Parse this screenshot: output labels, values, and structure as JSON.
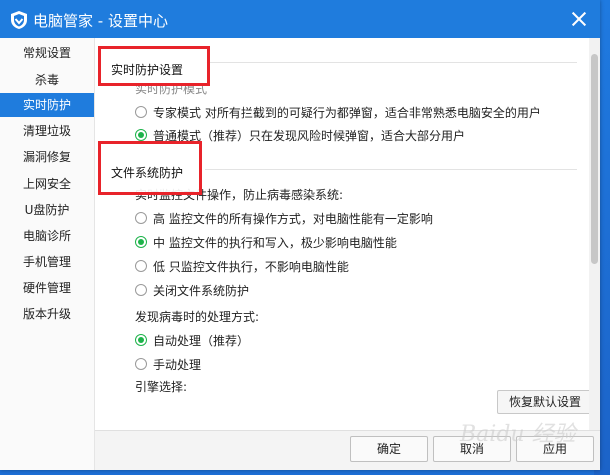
{
  "window": {
    "title": "电脑管家 - 设置中心"
  },
  "sidebar": {
    "items": [
      {
        "label": "常规设置"
      },
      {
        "label": "杀毒"
      },
      {
        "label": "实时防护",
        "active": true
      },
      {
        "label": "清理垃圾"
      },
      {
        "label": "漏洞修复"
      },
      {
        "label": "上网安全"
      },
      {
        "label": "U盘防护"
      },
      {
        "label": "电脑诊所"
      },
      {
        "label": "手机管理"
      },
      {
        "label": "硬件管理"
      },
      {
        "label": "版本升级"
      }
    ]
  },
  "realtime": {
    "header": "实时防护设置",
    "mode_label": "实时防护模式",
    "options": [
      {
        "label": "专家模式   对所有拦截到的可疑行为都弹窗，适合非常熟悉电脑安全的用户",
        "checked": false
      },
      {
        "label": "普通模式（推荐）只在发现风险时候弹窗，适合大部分用户",
        "checked": true
      }
    ]
  },
  "filesystem": {
    "header": "文件系统防护",
    "level_label": "实时监控文件操作，防止病毒感染系统:",
    "levels": [
      {
        "label": "高   监控文件的所有操作方式，对电脑性能有一定影响",
        "checked": false
      },
      {
        "label": "中   监控文件的执行和写入，极少影响电脑性能",
        "checked": true
      },
      {
        "label": "低   只监控文件执行，不影响电脑性能",
        "checked": false
      },
      {
        "label": "关闭文件系统防护",
        "checked": false
      }
    ],
    "handle_label": "发现病毒时的处理方式:",
    "handle_options": [
      {
        "label": "自动处理（推荐）",
        "checked": true
      },
      {
        "label": "手动处理",
        "checked": false
      }
    ],
    "engine_label": "引擎选择:"
  },
  "buttons": {
    "restore": "恢复默认设置",
    "ok": "确定",
    "cancel": "取消",
    "apply": "应用"
  },
  "colors": {
    "accent": "#1f7cdd",
    "radio_checked": "#1db34a",
    "highlight": "#e8232a"
  },
  "watermark": "Baidu 经验"
}
